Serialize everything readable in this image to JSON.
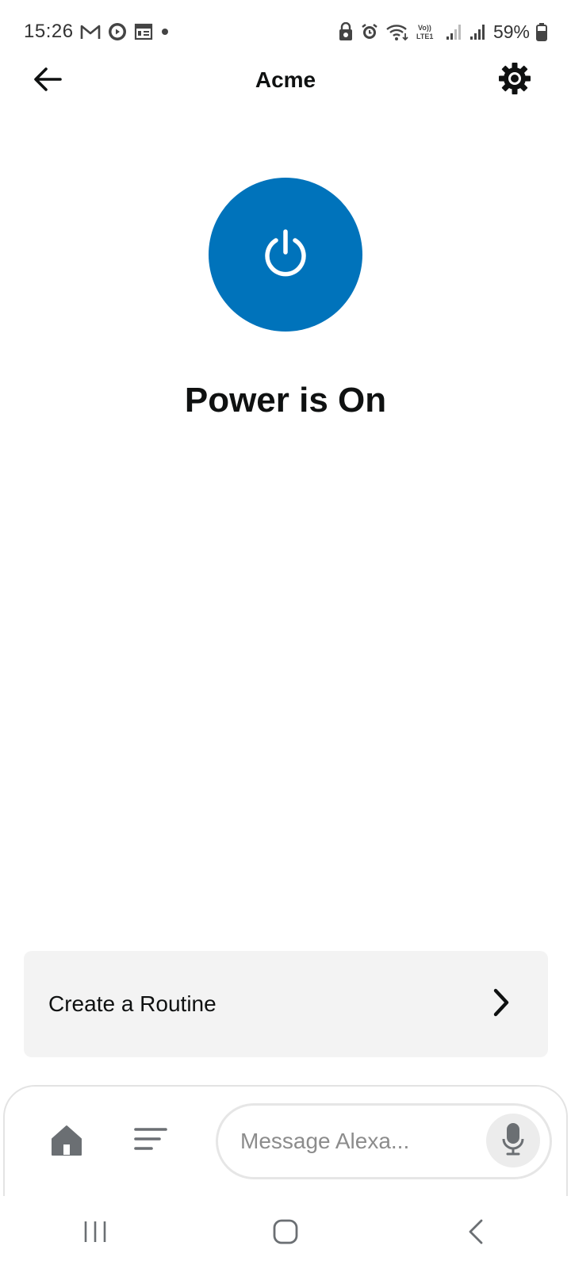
{
  "status_bar": {
    "time": "15:26",
    "battery_percent": "59%",
    "left_icons": [
      "gmail-icon",
      "media-play-icon",
      "calendar-icon",
      "dot-icon"
    ],
    "right_icons": [
      "lock-icon",
      "alarm-icon",
      "wifi-icon",
      "volte-icon",
      "signal-icon",
      "signal-icon",
      "battery-icon"
    ],
    "volte_label": "Vo)) LTE1"
  },
  "header": {
    "title": "Acme",
    "back_icon": "arrow-left-icon",
    "settings_icon": "gear-icon"
  },
  "device": {
    "power_icon": "power-icon",
    "power_button_color": "#0073bb",
    "status_text": "Power is On"
  },
  "routine": {
    "label": "Create a Routine",
    "chevron_icon": "chevron-right-icon"
  },
  "bottom_bar": {
    "home_icon": "home-icon",
    "activity_icon": "menu-lines-icon",
    "message_placeholder": "Message Alexa...",
    "mic_icon": "microphone-icon"
  },
  "nav_bar": {
    "recents_icon": "recents-icon",
    "home_icon": "home-circle-icon",
    "back_icon": "back-chevron-icon"
  }
}
